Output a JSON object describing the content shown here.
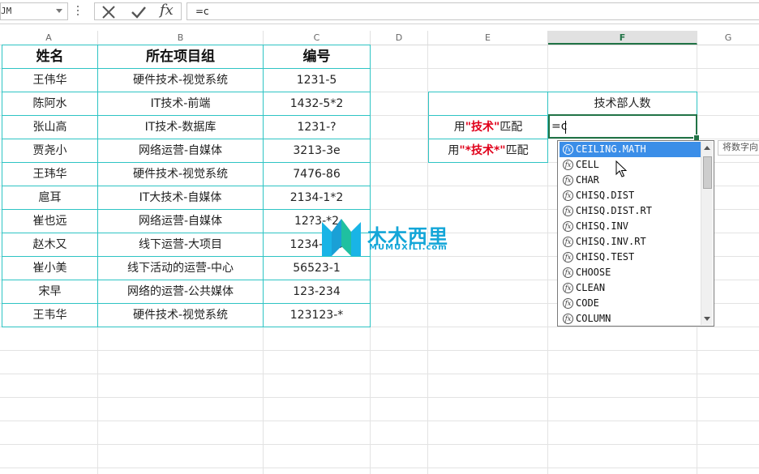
{
  "formula_bar": {
    "name_box": "JM",
    "cancel_icon": "close-icon",
    "enter_icon": "check-icon",
    "fx_label": "fx",
    "formula": "=c"
  },
  "columns": [
    "A",
    "B",
    "C",
    "D",
    "E",
    "F",
    "G"
  ],
  "active_column": "F",
  "table": {
    "headers": [
      "姓名",
      "所在项目组",
      "编号"
    ],
    "rows": [
      [
        "王伟华",
        "硬件技术-视觉系统",
        "1231-5"
      ],
      [
        "陈阿水",
        "IT技术-前端",
        "1432-5*2"
      ],
      [
        "张山高",
        "IT技术-数据库",
        "1231-?"
      ],
      [
        "贾尧小",
        "网络运营-自媒体",
        "3213-3e"
      ],
      [
        "王玮华",
        "硬件技术-视觉系统",
        "7476-86"
      ],
      [
        "扈耳",
        "IT大技术-自媒体",
        "2134-1*2"
      ],
      [
        "崔也远",
        "网络运营-自媒体",
        "12?3-*2"
      ],
      [
        "赵木又",
        "线下运营-大项目",
        "1234-?23"
      ],
      [
        "崔小美",
        "线下活动的运营-中心",
        "56523-1"
      ],
      [
        "宋早",
        "网络的运营-公共媒体",
        "123-234"
      ],
      [
        "王韦华",
        "硬件技术-视觉系统",
        "123123-*"
      ]
    ]
  },
  "side_table": {
    "header": "技术部人数",
    "row1": {
      "prefix": "用",
      "keyword": "\"技术\"",
      "suffix": "匹配",
      "value": "=c"
    },
    "row2": {
      "prefix": "用",
      "keyword": "\"*技术*\"",
      "suffix": "匹配"
    }
  },
  "autocomplete": {
    "items": [
      "CEILING.MATH",
      "CELL",
      "CHAR",
      "CHISQ.DIST",
      "CHISQ.DIST.RT",
      "CHISQ.INV",
      "CHISQ.INV.RT",
      "CHISQ.TEST",
      "CHOOSE",
      "CLEAN",
      "CODE",
      "COLUMN"
    ],
    "selected": "CEILING.MATH",
    "item_icon": "function-icon",
    "tooltip": "将数字向"
  },
  "watermark": {
    "title": "木木西里",
    "subtitle": "MUMUXILI.com"
  },
  "colors": {
    "accent_green": "#217346",
    "table_border": "#2ec4c4",
    "keyword_red": "#e0001a",
    "selection_blue": "#3b8ee8"
  }
}
